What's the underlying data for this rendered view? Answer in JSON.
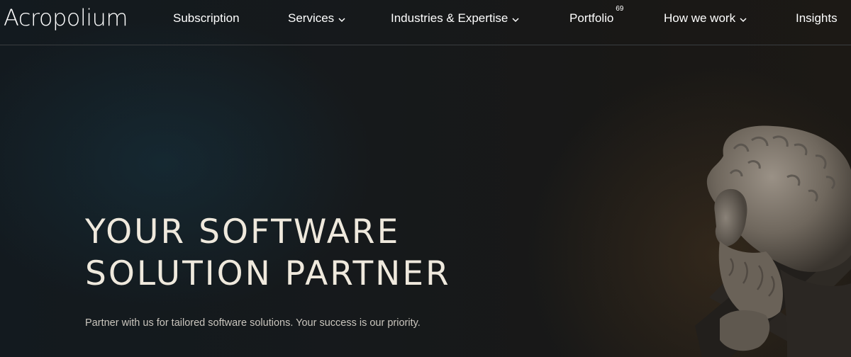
{
  "header": {
    "logo": "Acropolium",
    "nav": [
      {
        "label": "Subscription",
        "has_dropdown": false
      },
      {
        "label": "Services",
        "has_dropdown": true
      },
      {
        "label": "Industries & Expertise",
        "has_dropdown": true
      },
      {
        "label": "Portfolio",
        "badge": "69",
        "has_dropdown": false
      },
      {
        "label": "How we work",
        "has_dropdown": true
      },
      {
        "label": "Insights",
        "has_dropdown": false
      }
    ],
    "dropdown_icon": "chevron-down-icon"
  },
  "hero": {
    "title": "YOUR SOFTWARE\nSOLUTION PARTNER",
    "subtitle": "Partner with us for tailored software solutions. Your success is our priority.",
    "image": "philosopher-statue"
  },
  "colors": {
    "background": "#161718",
    "title": "#efe9dd",
    "text": "#ffffff",
    "subtitle": "#c9c5bd",
    "divider": "#3a3d40"
  }
}
